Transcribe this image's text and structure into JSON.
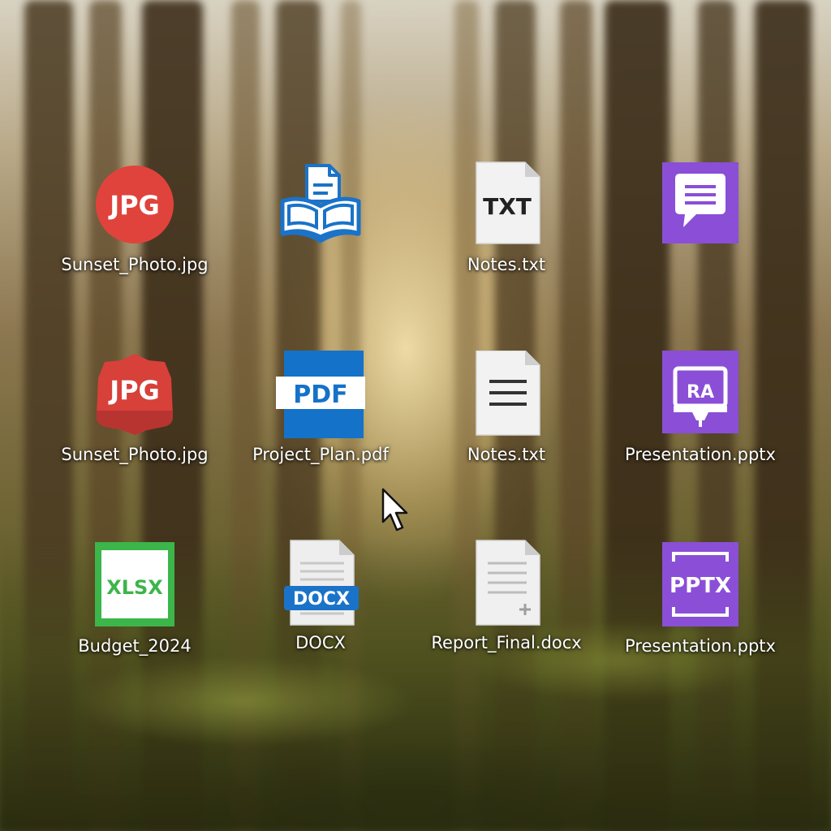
{
  "desktop": {
    "icons": [
      {
        "label": "Sunset_Photo.jpg",
        "type": "jpg-circle-icon",
        "badge": "JPG"
      },
      {
        "label": "",
        "type": "book-document-icon",
        "badge": ""
      },
      {
        "label": "Notes.txt",
        "type": "txt-file-icon",
        "badge": "TXT"
      },
      {
        "label": "",
        "type": "chat-bubble-icon",
        "badge": ""
      },
      {
        "label": "Sunset_Photo.jpg",
        "type": "jpg-badge-icon",
        "badge": "JPG"
      },
      {
        "label": "Project_Plan.pdf",
        "type": "pdf-file-icon",
        "badge": "PDF"
      },
      {
        "label": "Notes.txt",
        "type": "text-lines-file-icon",
        "badge": ""
      },
      {
        "label": "Presentation.pptx",
        "type": "presentation-screen-icon",
        "badge": "RA"
      },
      {
        "label": "Budget_2024",
        "type": "xlsx-file-icon",
        "badge": "XLSX"
      },
      {
        "label": "DOCX",
        "type": "docx-file-icon",
        "badge": "DOCX"
      },
      {
        "label": "Report_Final.docx",
        "type": "document-plus-icon",
        "badge": ""
      },
      {
        "label": "Presentation.pptx",
        "type": "pptx-file-icon",
        "badge": "PPTX"
      }
    ],
    "colors": {
      "jpg_red": "#e0433c",
      "doc_blue": "#1a73c8",
      "pdf_blue": "#1572c9",
      "purple": "#8a4fd6",
      "xlsx_green": "#3cb54a",
      "white": "#ffffff"
    }
  },
  "cursor": {
    "type": "arrow-cursor"
  }
}
